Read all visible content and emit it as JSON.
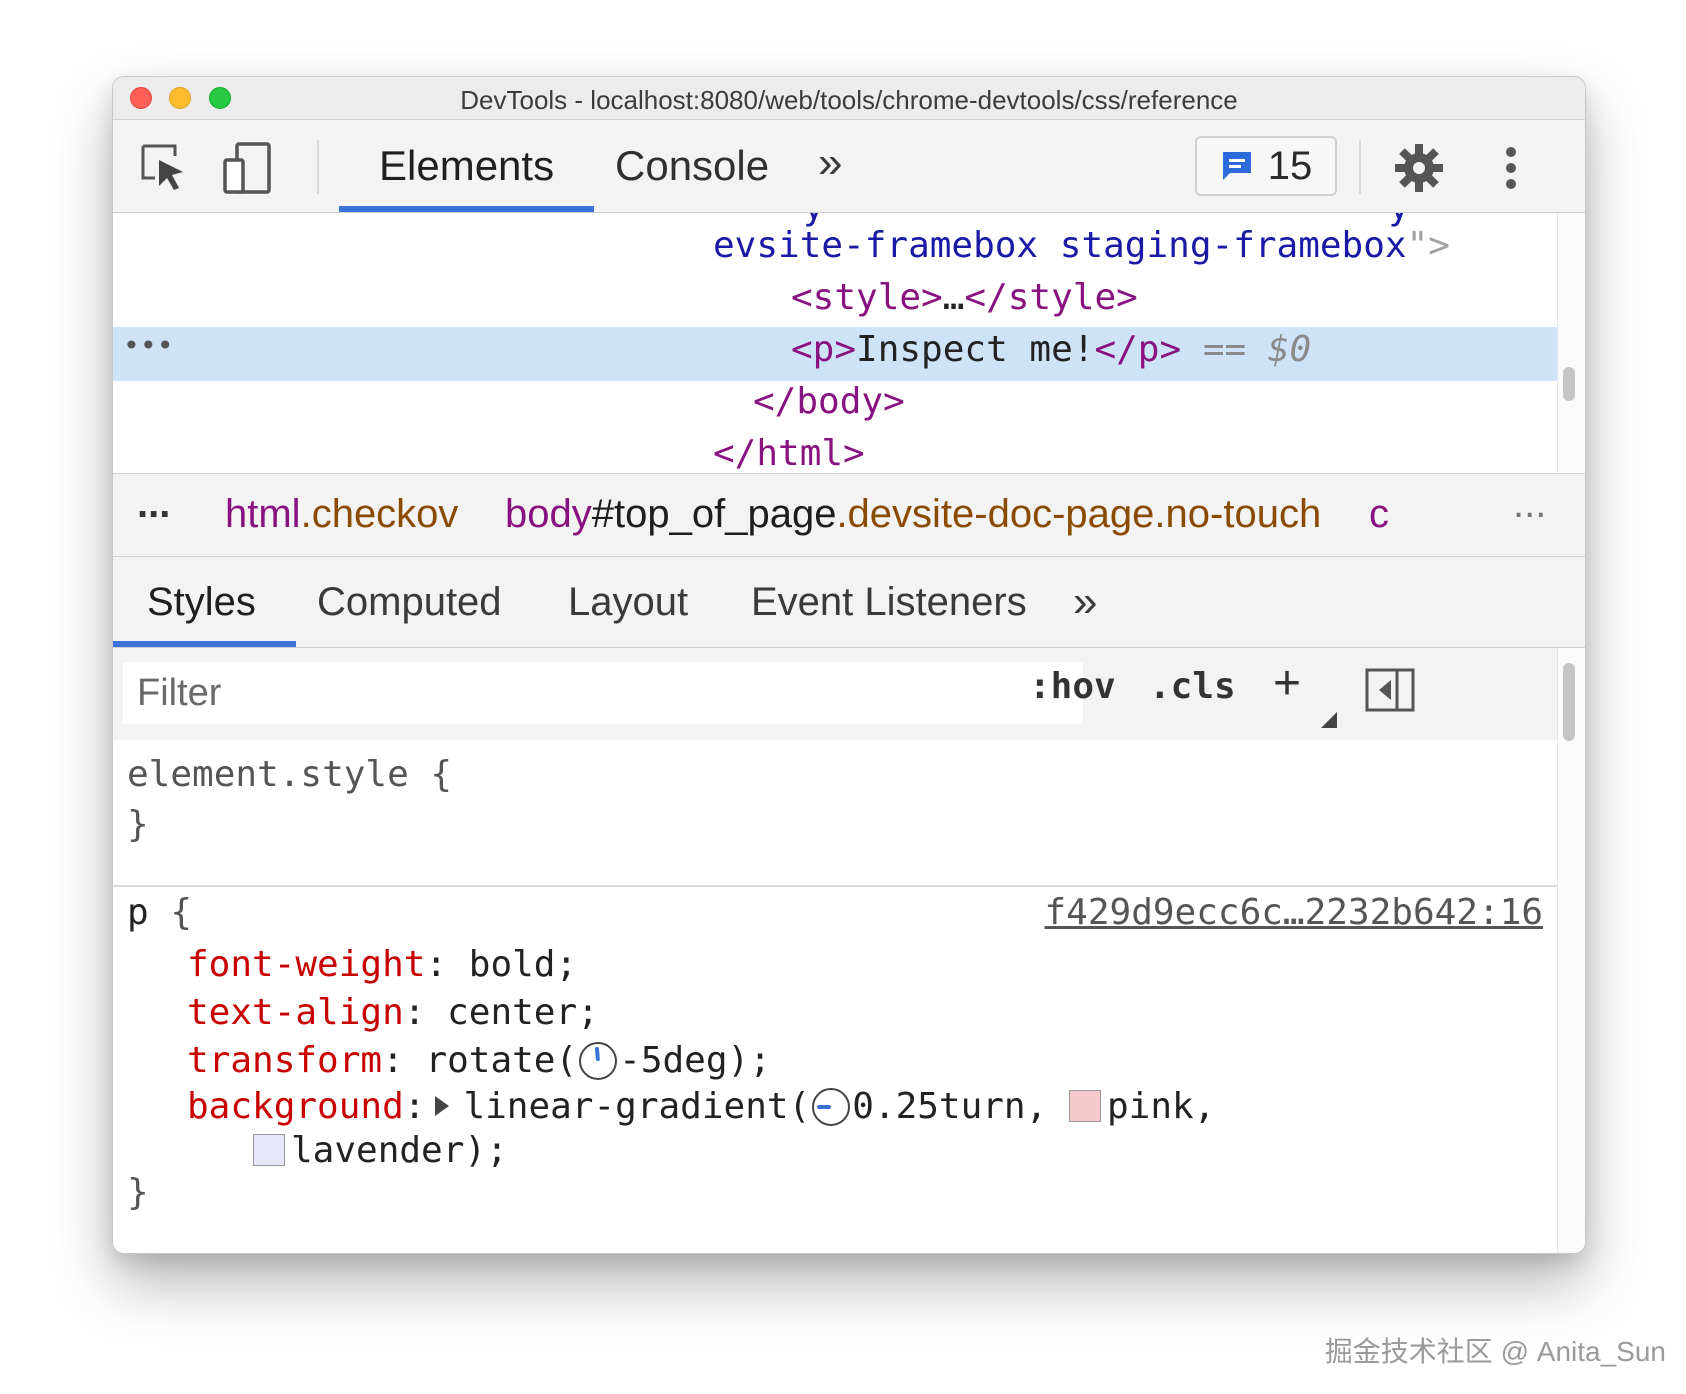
{
  "window": {
    "title": "DevTools - localhost:8080/web/tools/chrome-devtools/css/reference"
  },
  "toolbar": {
    "tabs": [
      "Elements",
      "Console"
    ],
    "more_tabs": "»",
    "issues_count": "15"
  },
  "dom_tree": {
    "line1_attr": "evsite-framebox staging-framebox",
    "line1_quote": "\"",
    "line1_close": ">",
    "style_open": "<style>",
    "style_ellipsis": "…",
    "style_close": "</style>",
    "selected_dots": "•••",
    "p_open": "<p>",
    "p_text": "Inspect me!",
    "p_close": "</p>",
    "eq": " == ",
    "dollar": "$0",
    "body_close": "</body>",
    "html_close": "</html>"
  },
  "breadcrumbs": {
    "leading_dots": "...",
    "items": [
      {
        "tag": "html",
        "id": "",
        "classes": ".checkov"
      },
      {
        "tag": "body",
        "id": "#top_of_page",
        "classes": ".devsite-doc-page.no-touch"
      },
      {
        "tag": "c",
        "id": "",
        "classes": ""
      }
    ],
    "trailing_dots": "..."
  },
  "sub_tabs": [
    "Styles",
    "Computed",
    "Layout",
    "Event Listeners"
  ],
  "sub_more": "»",
  "filter": {
    "placeholder": "Filter",
    "hov": ":hov",
    "cls": ".cls",
    "plus": "+"
  },
  "styles": {
    "element_style_selector": "element.style {",
    "close_brace": "}",
    "rule_selector": "p",
    "rule_open": " {",
    "source": "f429d9ecc6c…2232b642:16",
    "props": [
      {
        "name": "font-weight",
        "value": "bold;"
      },
      {
        "name": "text-align",
        "value": "center;"
      },
      {
        "name": "transform",
        "value_pre": "rotate(",
        "value_post": "-5deg);"
      },
      {
        "name": "background",
        "value_pre": "linear-gradient(",
        "value_angle": "0.25turn, ",
        "color1": "pink,",
        "color2": "lavender);"
      }
    ],
    "swatch_colors": {
      "pink": "#f4c9cc",
      "lavender": "#e6e6fa"
    }
  },
  "watermark": "掘金技术社区 @ Anita_Sun"
}
